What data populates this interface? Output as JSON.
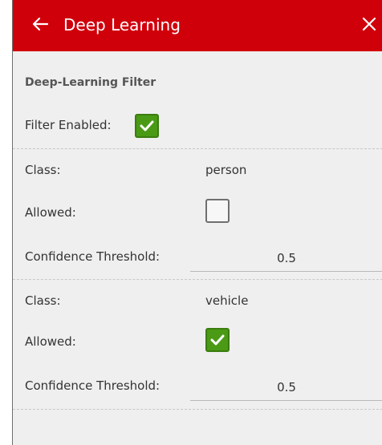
{
  "header": {
    "title": "Deep Learning",
    "back_icon": "arrow-left-icon",
    "close_icon": "close-icon"
  },
  "filter": {
    "section_title": "Deep-Learning Filter",
    "enabled_label": "Filter Enabled:",
    "enabled": true
  },
  "classes": [
    {
      "class_label": "Class:",
      "class_value": "person",
      "allowed_label": "Allowed:",
      "allowed": false,
      "threshold_label": "Confidence Threshold:",
      "threshold_value": "0.5"
    },
    {
      "class_label": "Class:",
      "class_value": "vehicle",
      "allowed_label": "Allowed:",
      "allowed": true,
      "threshold_label": "Confidence Threshold:",
      "threshold_value": "0.5"
    }
  ],
  "colors": {
    "header_bg": "#d0000b",
    "checkbox_checked": "#4a9a15",
    "panel_bg": "#efefef"
  }
}
